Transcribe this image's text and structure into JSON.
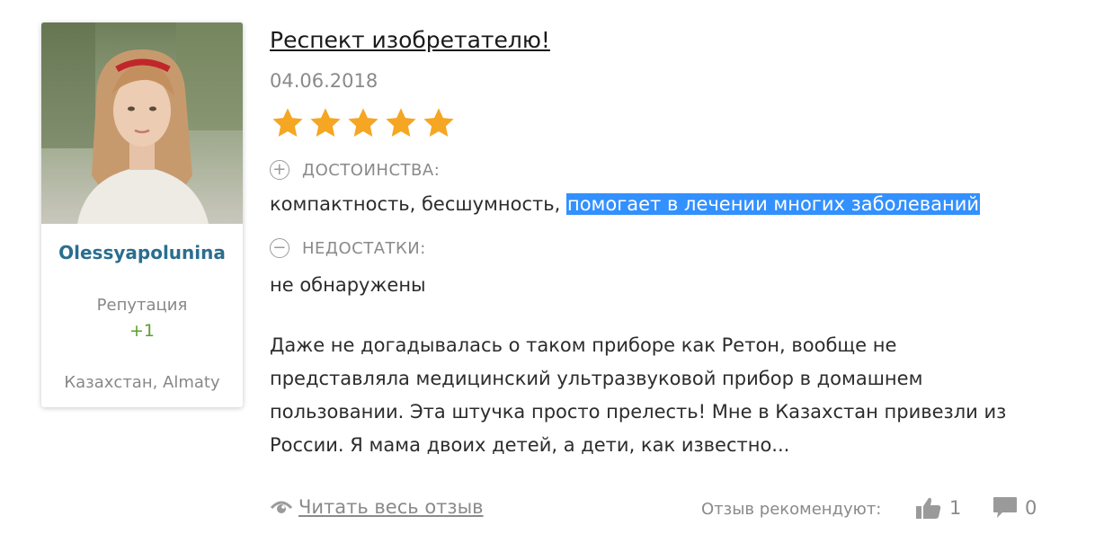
{
  "user": {
    "username": "Olessyapolunina",
    "reputation_label": "Репутация",
    "reputation_value": "+1",
    "location": "Казахстан, Almaty"
  },
  "review": {
    "title": "Респект изобретателю!",
    "date": "04.06.2018",
    "rating": 5,
    "rating_max": 5,
    "star_color": "#f5a623",
    "pros_label": "ДОСТОИНСТВА:",
    "pros_text_plain": "компактность, бесшумность, ",
    "pros_text_highlighted": "помогает в лечении многих заболеваний",
    "cons_label": "НЕДОСТАТКИ:",
    "cons_text": "не обнаружены",
    "body_lines": [
      "Даже не догадывалась о таком приборе как Ретон, вообще не",
      "представляла медицинский ультразвуковой прибор в домашнем",
      "пользовании. Эта штучка просто прелесть! Мне в Казахстан привезли из",
      "России. Я мама двоих детей, а дети, как известно..."
    ]
  },
  "footer": {
    "read_more_label": "Читать весь отзыв",
    "recommend_label": "Отзыв рекомендуют:",
    "likes_count": "1",
    "comments_count": "0"
  },
  "colors": {
    "username": "#2a6e8f",
    "reputation_positive": "#5aa02c",
    "highlight": "#3390ff"
  }
}
